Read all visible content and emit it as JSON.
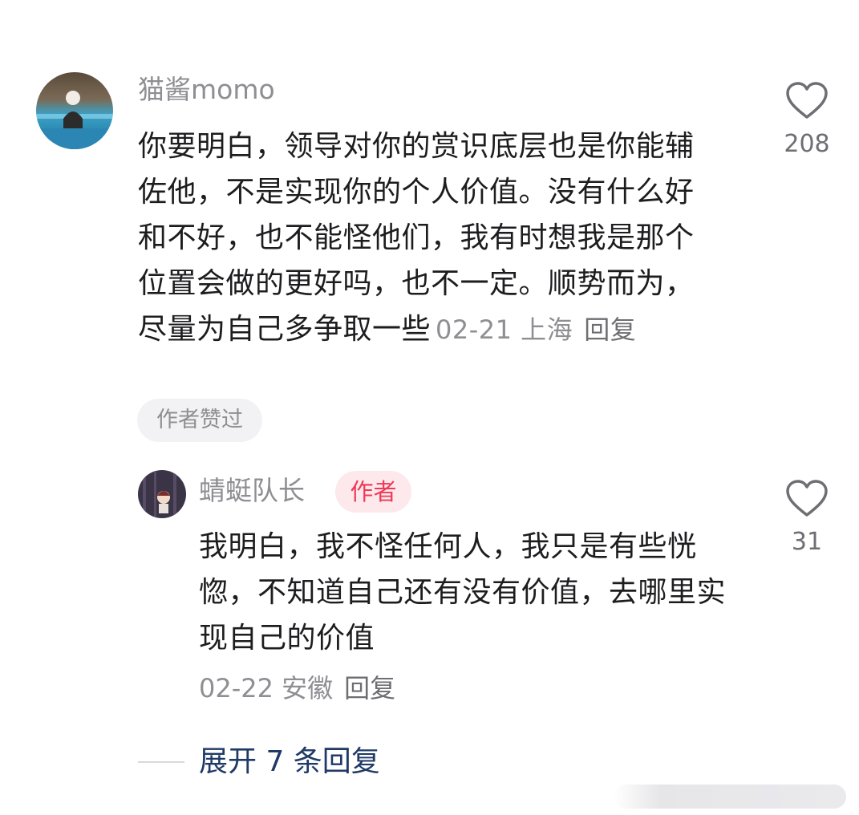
{
  "comment": {
    "username": "猫酱momo",
    "text": "你要明白，领导对你的赏识底层也是你能辅佐他，不是实现你的个人价值。没有什么好和不好，也不能怪他们，我有时想我是那个位置会做的更好吗，也不一定。顺势而为，尽量为自己多争取一些",
    "date_location": "02-21 上海",
    "reply_label": "回复",
    "liked_badge": "作者赞过",
    "like_count": "208"
  },
  "reply": {
    "username": "蜻蜓队长",
    "author_badge": "作者",
    "text": "我明白，我不怪任何人，我只是有些恍惚，不知道自己还有没有价值，去哪里实现自己的价值",
    "date_location": "02-22 安徽",
    "reply_label": "回复",
    "like_count": "31"
  },
  "expand_label": "展开 7 条回复",
  "icons": {
    "like": "heart-outline-icon"
  },
  "colors": {
    "text": "#1d1d1f",
    "muted": "#8e8e93",
    "author_badge": "#ee3a56",
    "expand": "#1f3a66"
  }
}
